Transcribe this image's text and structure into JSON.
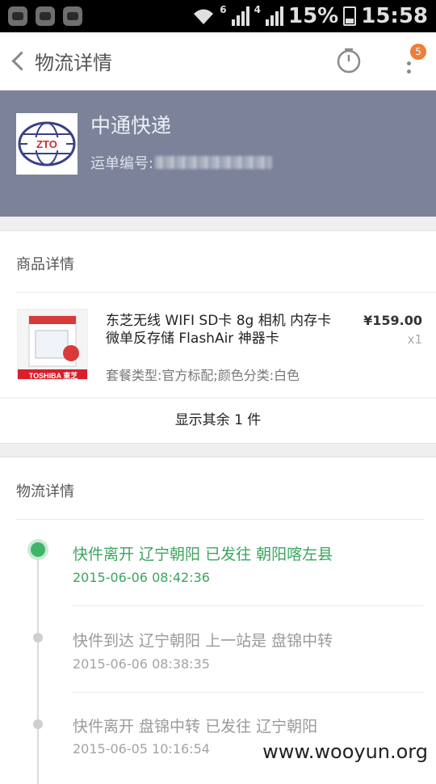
{
  "status_bar": {
    "battery": "15%",
    "time": "15:58",
    "signal_labels": [
      "6",
      "4"
    ]
  },
  "app_bar": {
    "title": "物流详情",
    "badge_count": "5"
  },
  "courier": {
    "logo_text": "ZTO",
    "name": "中通快递",
    "tracking_label": "运单编号:"
  },
  "goods": {
    "section_title": "商品详情",
    "product_name": "东芝无线 WIFI SD卡 8g 相机 内存卡 微单反存储 FlashAir 神器卡",
    "spec": "套餐类型:官方标配;颜色分类:白色",
    "price": "¥159.00",
    "quantity": "x1",
    "thumb_brand": "TOSHIBA 東芝",
    "show_more": "显示其余 1 件"
  },
  "logistics": {
    "section_title": "物流详情",
    "events": [
      {
        "status": "快件离开 辽宁朝阳 已发往 朝阳喀左县",
        "time": "2015-06-06 08:42:36"
      },
      {
        "status": "快件到达 辽宁朝阳 上一站是 盘锦中转",
        "time": "2015-06-06 08:38:35"
      },
      {
        "status": "快件离开 盘锦中转 已发往 辽宁朝阳",
        "time": "2015-06-05 10:16:54"
      }
    ]
  },
  "watermark": "www.wooyun.org",
  "colors": {
    "header_bg": "#7b8299",
    "active_green": "#3aa55c",
    "badge_orange": "#f07d3a"
  }
}
